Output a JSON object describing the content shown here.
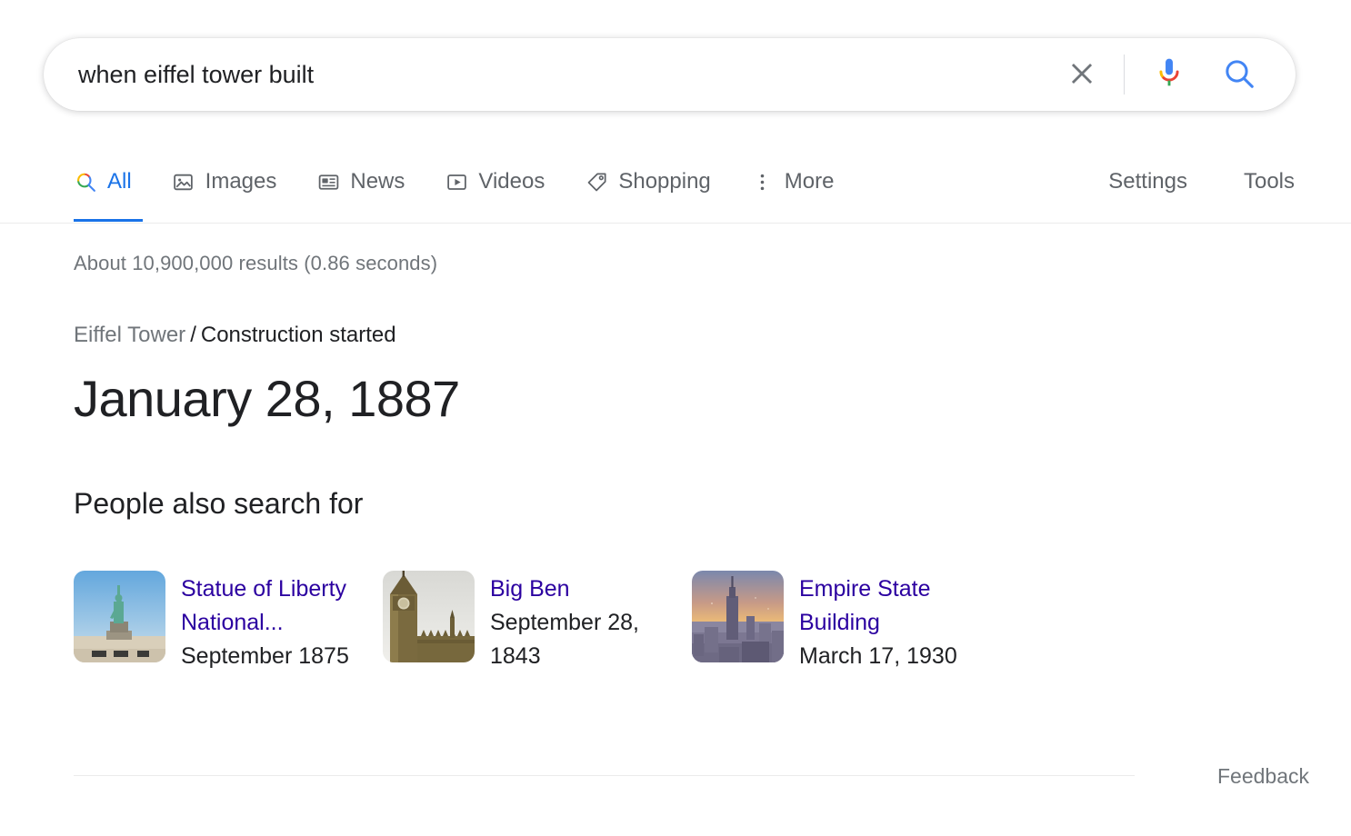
{
  "search": {
    "query": "when eiffel tower built",
    "placeholder": "Search",
    "clear_icon": "close-icon",
    "mic_icon": "microphone-icon",
    "search_icon": "search-icon"
  },
  "nav": {
    "tabs": [
      {
        "label": "All",
        "icon": "google-search-icon",
        "active": true
      },
      {
        "label": "Images",
        "icon": "image-icon",
        "active": false
      },
      {
        "label": "News",
        "icon": "news-icon",
        "active": false
      },
      {
        "label": "Videos",
        "icon": "video-play-icon",
        "active": false
      },
      {
        "label": "Shopping",
        "icon": "price-tag-icon",
        "active": false
      },
      {
        "label": "More",
        "icon": "more-vertical-icon",
        "active": false
      }
    ],
    "settings_label": "Settings",
    "tools_label": "Tools"
  },
  "results": {
    "stats": "About 10,900,000 results (0.86 seconds)"
  },
  "knowledge_panel": {
    "entity": "Eiffel Tower",
    "separator": "/",
    "attribute": "Construction started",
    "answer": "January 28, 1887"
  },
  "people_also_search_for": {
    "title": "People also search for",
    "items": [
      {
        "name": "Statue of Liberty National...",
        "date": "September 1875",
        "thumbnail": "statue-of-liberty-thumbnail",
        "visited": true
      },
      {
        "name": "Big Ben",
        "date": "September 28, 1843",
        "thumbnail": "big-ben-thumbnail",
        "visited": true
      },
      {
        "name": "Empire State Building",
        "date": "March 17, 1930",
        "thumbnail": "empire-state-building-thumbnail",
        "visited": true
      }
    ]
  },
  "footer": {
    "feedback_label": "Feedback"
  },
  "colors": {
    "link": "#1a0dab",
    "visited_link": "#2b00a0",
    "accent_blue": "#1a73e8",
    "muted_text": "#70757a",
    "primary_text": "#202124"
  }
}
